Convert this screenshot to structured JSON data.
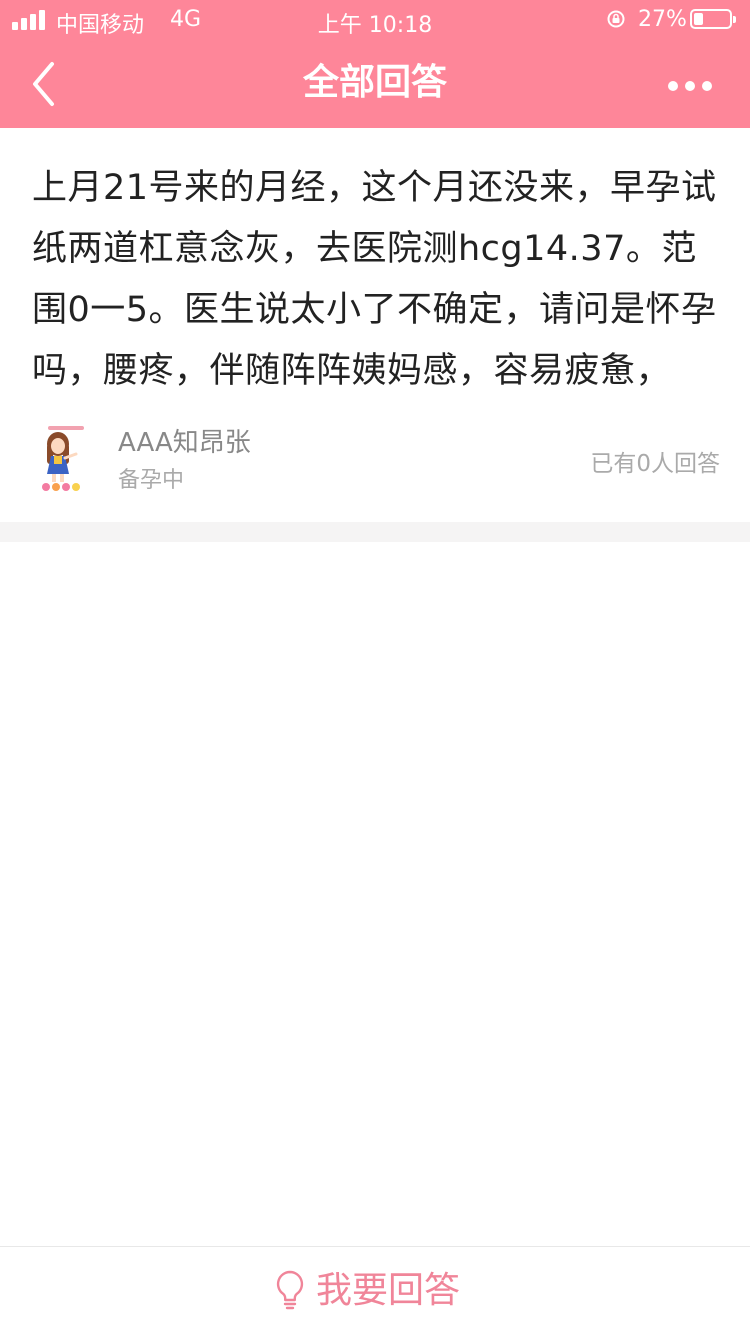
{
  "status_bar": {
    "carrier": "中国移动",
    "network": "4G",
    "time": "上午 10:18",
    "battery_percent": "27%",
    "battery_level": 0.27,
    "signal_bars": 4
  },
  "nav": {
    "title": "全部回答",
    "back_icon": "chevron-left-icon",
    "more_icon": "more-dots-icon"
  },
  "question": {
    "text": "上月21号来的月经，这个月还没来，早孕试纸两道杠意念灰，去医院测hcg14.37。范围0一5。医生说太小了不确定，请问是怀孕吗，腰疼，伴随阵阵姨妈感，容易疲惫，",
    "author": {
      "name": "AAA知昂张",
      "status": "备孕中",
      "avatar_icon": "cartoon-girl-avatar"
    },
    "answer_count_text": "已有0人回答"
  },
  "bottom_bar": {
    "answer_label": "我要回答",
    "answer_icon": "lightbulb-icon"
  },
  "colors": {
    "brand_pink": "#fe8699",
    "answer_pink": "#f08599",
    "text_primary": "#222222",
    "text_secondary": "#888888",
    "text_muted": "#aaaaaa"
  }
}
